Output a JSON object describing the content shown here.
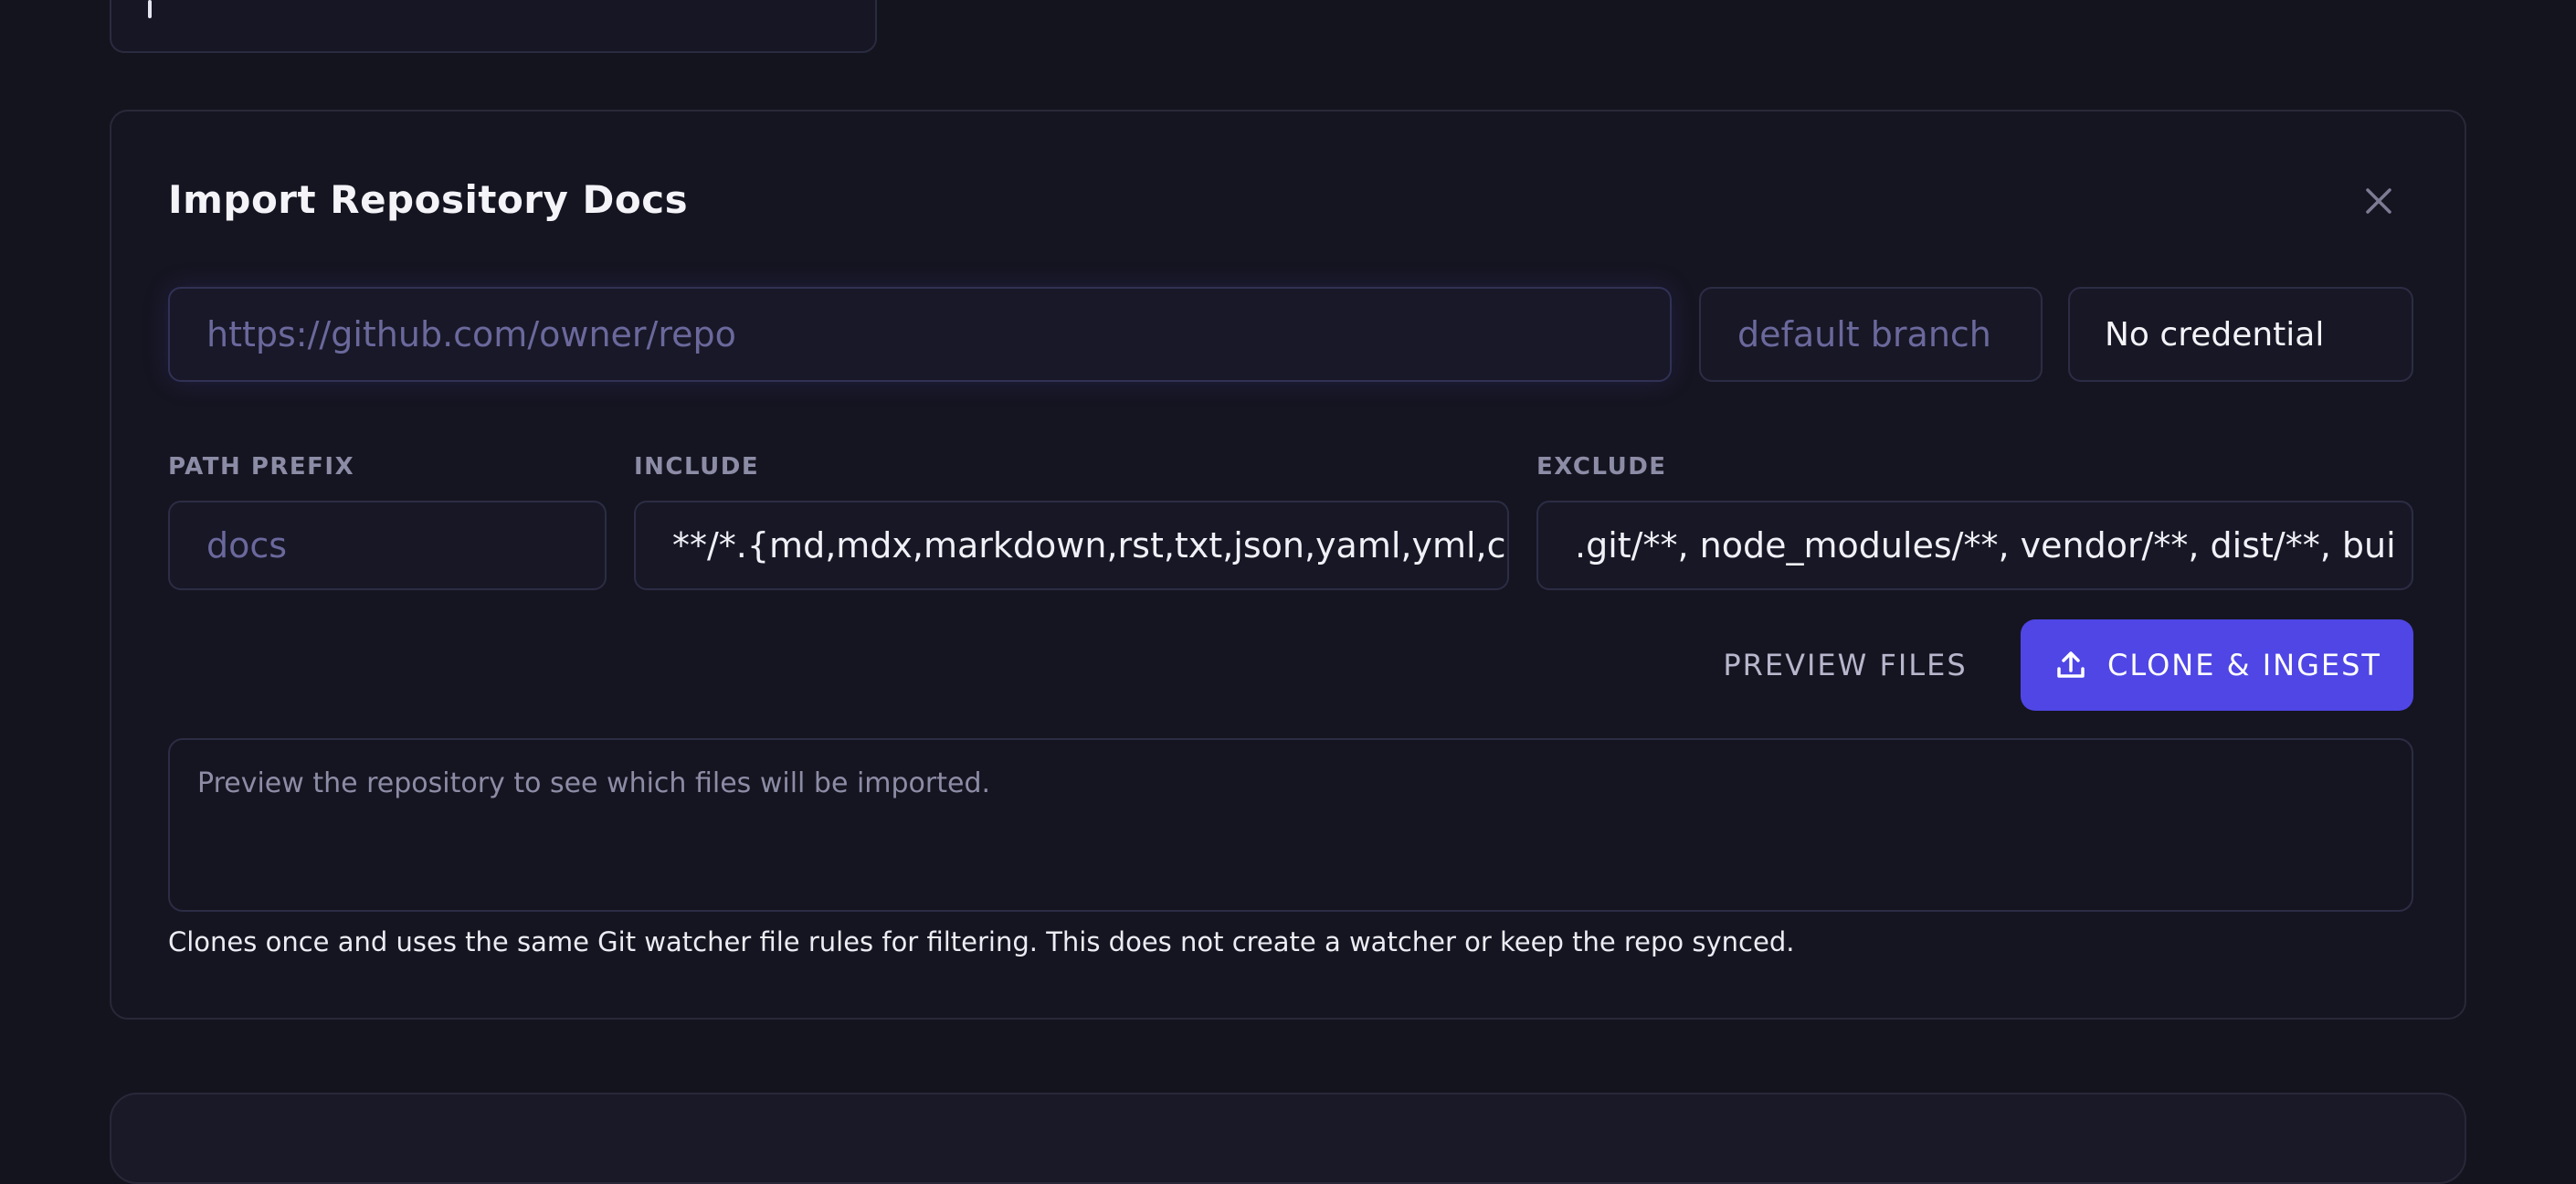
{
  "panel": {
    "title": "Import Repository Docs",
    "close_icon": "close-icon",
    "repo_url": {
      "value": "",
      "placeholder": "https://github.com/owner/repo"
    },
    "branch": {
      "value": "",
      "placeholder": "default branch"
    },
    "credential": {
      "selected": "No credential"
    },
    "path_prefix": {
      "label": "PATH PREFIX",
      "value": "",
      "placeholder": "docs"
    },
    "include": {
      "label": "INCLUDE",
      "value": "**/*.{md,mdx,markdown,rst,txt,json,yaml,yml,csv"
    },
    "exclude": {
      "label": "EXCLUDE",
      "value": ".git/**, node_modules/**, vendor/**, dist/**, bui"
    },
    "buttons": {
      "preview": "PREVIEW FILES",
      "clone": "CLONE & INGEST",
      "clone_icon": "upload-icon"
    },
    "preview_placeholder": "Preview the repository to see which files will be imported.",
    "note": "Clones once and uses the same Git watcher file rules for filtering. This does not create a watcher or keep the repo synced."
  },
  "colors": {
    "background": "#14141f",
    "accent": "#4f46e5",
    "placeholder": "#6b689c",
    "label": "#8d8ca6"
  }
}
